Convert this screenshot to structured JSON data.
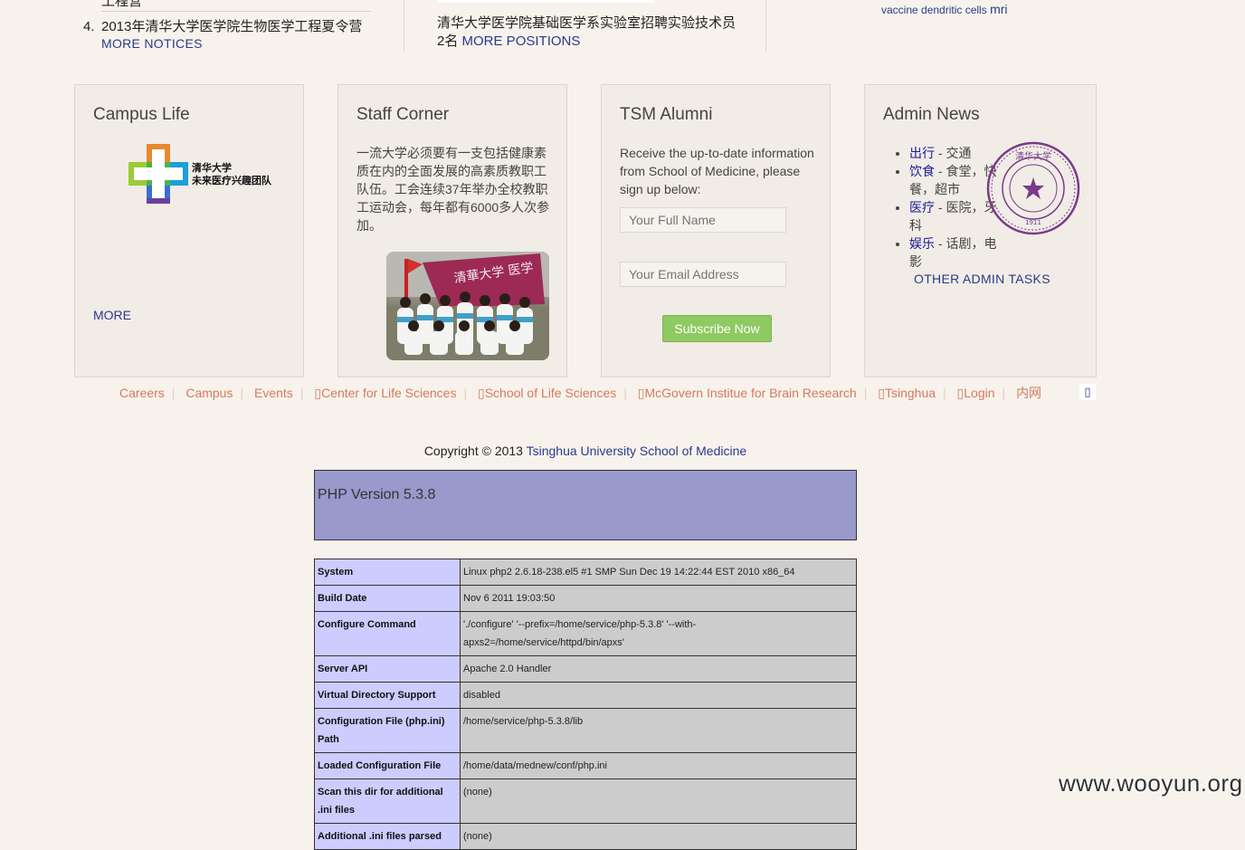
{
  "top": {
    "cut_text": "工程营",
    "notice_number": "4.",
    "notice_text": "2013年清华大学医学院生物医学工程夏令营",
    "more_notices": "MORE NOTICES",
    "position_text": "清华大学医学院基础医学系实验室招聘实验技术员2名",
    "more_positions": "MORE POSITIONS",
    "research_tags": "vaccine dendritic cells",
    "research_tag_big": "mri"
  },
  "campus_life": {
    "title": "Campus Life",
    "logo_line1": "清华大学",
    "logo_line2": "未来医疗兴趣团队",
    "more": "MORE"
  },
  "staff_corner": {
    "title": "Staff Corner",
    "text": "一流大学必须要有一支包括健康素质在内的全面发展的高素质教职工队伍。工会连续37年举办全校教职工运动会，每年都有6000多人次参加。",
    "banner_text": "清華大学 医学"
  },
  "alumni": {
    "title": "TSM Alumni",
    "text": "Receive the up-to-date information from School of Medicine, please sign up below:",
    "name_placeholder": "Your Full Name",
    "email_placeholder": "Your Email Address",
    "subscribe": "Subscribe Now"
  },
  "admin_news": {
    "title": "Admin News",
    "items": [
      {
        "link": "出行",
        "rest": " - 交通"
      },
      {
        "link": "饮食",
        "rest": " - 食堂，快餐，超市"
      },
      {
        "link": "医疗",
        "rest": " - 医院，牙科"
      },
      {
        "link": "娱乐",
        "rest": " - 话剧，电影"
      }
    ],
    "seal_text": "清华大学",
    "seal_year": "1911",
    "other_tasks": "OTHER ADMIN TASKS"
  },
  "footer_nav": {
    "items": [
      "Careers",
      "Campus",
      "Events",
      "Center for Life Sciences",
      "School of Life Sciences",
      "McGovern Institue for Brain Research",
      "Tsinghua",
      "Login",
      "内网"
    ],
    "end_glyph": "▯"
  },
  "copyright": {
    "prefix": "Copyright © 2013 ",
    "link": "Tsinghua University School of Medicine"
  },
  "php": {
    "version": "PHP Version 5.3.8",
    "rows": [
      {
        "key": "System",
        "value": "Linux php2 2.6.18-238.el5 #1 SMP Sun Dec 19 14:22:44 EST 2010 x86_64"
      },
      {
        "key": "Build Date",
        "value": "Nov 6 2011 19:03:50"
      },
      {
        "key": "Configure Command",
        "value": "'./configure' '--prefix=/home/service/php-5.3.8' '--with-apxs2=/home/service/httpd/bin/apxs'"
      },
      {
        "key": "Server API",
        "value": "Apache 2.0 Handler"
      },
      {
        "key": "Virtual Directory Support",
        "value": "disabled"
      },
      {
        "key": "Configuration File (php.ini) Path",
        "value": "/home/service/php-5.3.8/lib"
      },
      {
        "key": "Loaded Configuration File",
        "value": "/home/data/mednew/conf/php.ini"
      },
      {
        "key": "Scan this dir for additional .ini files",
        "value": "(none)"
      },
      {
        "key": "Additional .ini files parsed",
        "value": "(none)"
      }
    ]
  },
  "watermark": "www.wooyun.org",
  "colors": {
    "page_bg": "#f7f2ec",
    "link": "#2a3a8a",
    "footer_link": "#d57a5c",
    "subscribe_btn": "#8fc962",
    "php_header": "#9999cc",
    "php_key": "#ccccff",
    "php_value": "#cccccc",
    "seal": "#7a3a8a"
  }
}
